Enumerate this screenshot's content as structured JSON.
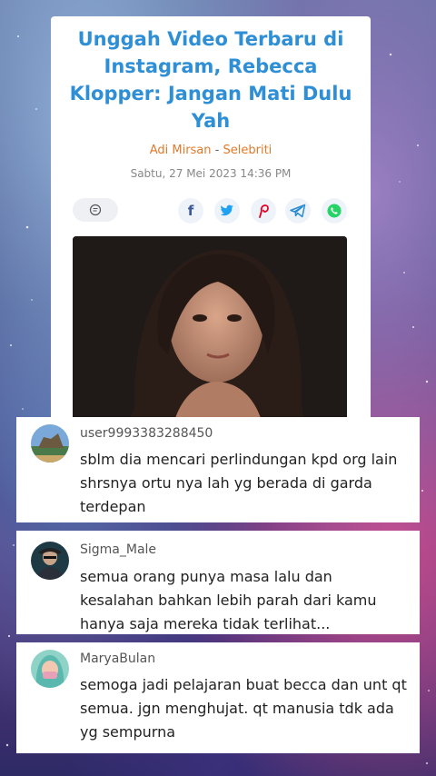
{
  "article": {
    "title": "Unggah Video Terbaru di Instagram, Rebecca Klopper: Jangan Mati Dulu Yah",
    "author": "Adi Mirsan",
    "separator": "-",
    "category": "Selebriti",
    "date": "Sabtu, 27 Mei 2023 14:36 PM",
    "share_icons": [
      "facebook-icon",
      "twitter-icon",
      "pinterest-icon",
      "telegram-icon",
      "whatsapp-icon"
    ]
  },
  "comments": [
    {
      "username": "user9993383288450",
      "text": "sblm dia mencari perlindungan kpd org lain shrsnya ortu nya lah yg berada di garda terdepan"
    },
    {
      "username": "Sigma_Male",
      "text": "semua orang punya masa lalu dan kesalahan bahkan lebih parah dari kamu hanya saja mereka tidak terlihat..."
    },
    {
      "username": "MaryaBulan",
      "text": "semoga jadi pelajaran buat becca dan unt qt semua. jgn menghujat. qt manusia tdk ada yg sempurna"
    }
  ],
  "colors": {
    "title": "#2f8fd6",
    "author": "#e07a2a",
    "facebook": "#3b5998",
    "twitter": "#1da1f2",
    "pinterest": "#e60023",
    "telegram": "#2a8bd0",
    "whatsapp": "#25d366"
  }
}
